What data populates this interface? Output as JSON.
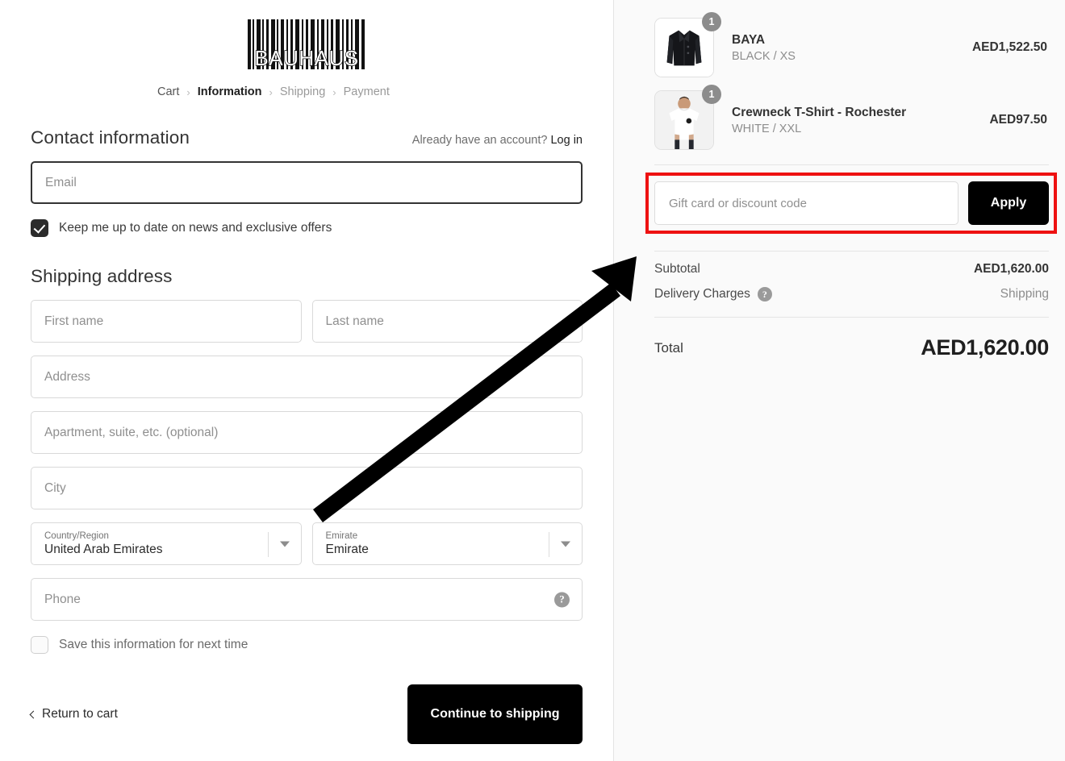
{
  "brand": {
    "logo_text": "BAUHAUS",
    "logo_type": "barcode-logo"
  },
  "breadcrumb": {
    "items": [
      {
        "label": "Cart",
        "state": "done"
      },
      {
        "label": "Information",
        "state": "current"
      },
      {
        "label": "Shipping",
        "state": "future"
      },
      {
        "label": "Payment",
        "state": "future"
      }
    ],
    "separator": "›"
  },
  "contact": {
    "title": "Contact information",
    "account_prompt": "Already have an account?",
    "login_label": "Log in",
    "email_placeholder": "Email",
    "email_value": "",
    "newsletter_label": "Keep me up to date on news and exclusive offers",
    "newsletter_checked": true
  },
  "shipping": {
    "title": "Shipping address",
    "first_name_placeholder": "First name",
    "first_name_value": "",
    "last_name_placeholder": "Last name",
    "last_name_value": "",
    "address_placeholder": "Address",
    "address_value": "",
    "apartment_placeholder": "Apartment, suite, etc. (optional)",
    "apartment_value": "",
    "city_placeholder": "City",
    "city_value": "",
    "country_label": "Country/Region",
    "country_value": "United Arab Emirates",
    "emirate_label": "Emirate",
    "emirate_value": "Emirate",
    "phone_placeholder": "Phone",
    "phone_value": "",
    "save_info_label": "Save this information for next time",
    "save_info_checked": false
  },
  "footer": {
    "return_label": "Return to cart",
    "continue_label": "Continue to shipping"
  },
  "order_summary": {
    "items": [
      {
        "name": "BAYA",
        "variant": "BLACK / XS",
        "price": "AED1,522.50",
        "quantity": "1",
        "image": "black-leather-jacket"
      },
      {
        "name": "Crewneck T-Shirt - Rochester",
        "variant": "WHITE / XXL",
        "price": "AED97.50",
        "quantity": "1",
        "image": "white-tshirt-model"
      }
    ],
    "discount": {
      "placeholder": "Gift card or discount code",
      "value": "",
      "apply_label": "Apply"
    },
    "subtotal_label": "Subtotal",
    "subtotal_value": "AED1,620.00",
    "delivery_label": "Delivery Charges",
    "delivery_value": "Shipping",
    "total_label": "Total",
    "total_value": "AED1,620.00"
  },
  "annotations": {
    "highlight_color": "#ee1111",
    "highlight_target": "discount-code-row",
    "arrow_color": "#000000"
  }
}
